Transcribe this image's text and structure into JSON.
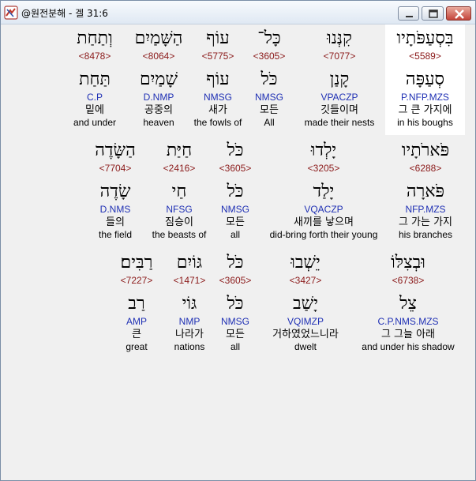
{
  "window": {
    "title": "@원전분해 - 겔 31:6"
  },
  "rows": [
    [
      {
        "surface": "בִּסְעַפֹּתָיו",
        "strong": "<5589>",
        "lemma": "סְעַפָּה",
        "parse": "P.NFP.MZS",
        "korean": "그 큰 가지에",
        "english": "in his boughs",
        "selected": true
      },
      {
        "surface": "קִנְּנוּ",
        "strong": "<7077>",
        "lemma": "קָנַן",
        "parse": "VPACZP",
        "korean": "깃들이며",
        "english": "made their nests"
      },
      {
        "surface": "כָּל־",
        "strong": "<3605>",
        "lemma": "כֹּל",
        "parse": "NMSG",
        "korean": "모든",
        "english": "All"
      },
      {
        "surface": "עוֹף",
        "strong": "<5775>",
        "lemma": "עוֹף",
        "parse": "NMSG",
        "korean": "새가",
        "english": "the fowls of"
      },
      {
        "surface": "הַשָּׁמַיִם",
        "strong": "<8064>",
        "lemma": "שָׁמַיִם",
        "parse": "D.NMP",
        "korean": "공중의",
        "english": "heaven"
      },
      {
        "surface": "וְתַחַת",
        "strong": "<8478>",
        "lemma": "תַּחַת",
        "parse": "C.P",
        "korean": "밑에",
        "english": "and under"
      }
    ],
    [
      {
        "surface": "פֹּארֹתָיו",
        "strong": "<6288>",
        "lemma": "פֹּארָה",
        "parse": "NFP.MZS",
        "korean": "그 가는 가지",
        "english": "his branches"
      },
      {
        "surface": "יָלְדוּ",
        "strong": "<3205>",
        "lemma": "יָלַד",
        "parse": "VQACZP",
        "korean": "새끼를 낳으며",
        "english": "did-bring forth their young"
      },
      {
        "surface": "כֹּל",
        "strong": "<3605>",
        "lemma": "כֹּל",
        "parse": "NMSG",
        "korean": "모든",
        "english": "all"
      },
      {
        "surface": "חַיַּת",
        "strong": "<2416>",
        "lemma": "חַי",
        "parse": "NFSG",
        "korean": "짐승이",
        "english": "the beasts of"
      },
      {
        "surface": "הַשָּׂדֶה",
        "strong": "<7704>",
        "lemma": "שָׂדֶה",
        "parse": "D.NMS",
        "korean": "들의",
        "english": "the field"
      }
    ],
    [
      {
        "surface": "וּבְצִלּוֹ",
        "strong": "<6738>",
        "lemma": "צֵל",
        "parse": "C.P.NMS.MZS",
        "korean": "그 그늘 아래",
        "english": "and under his shadow"
      },
      {
        "surface": "יֵשְׁבוּ",
        "strong": "<3427>",
        "lemma": "יָשַׁב",
        "parse": "VQIMZP",
        "korean": "거하였었느니라",
        "english": "dwelt"
      },
      {
        "surface": "כֹּל",
        "strong": "<3605>",
        "lemma": "כֹּל",
        "parse": "NMSG",
        "korean": "모든",
        "english": "all"
      },
      {
        "surface": "גּוֹיִם",
        "strong": "<1471>",
        "lemma": "גּוֹי",
        "parse": "NMP",
        "korean": "나라가",
        "english": "nations"
      },
      {
        "surface": "רַבִּים׃",
        "strong": "<7227>",
        "lemma": "רַב",
        "parse": "AMP",
        "korean": "큰",
        "english": "great"
      }
    ]
  ]
}
